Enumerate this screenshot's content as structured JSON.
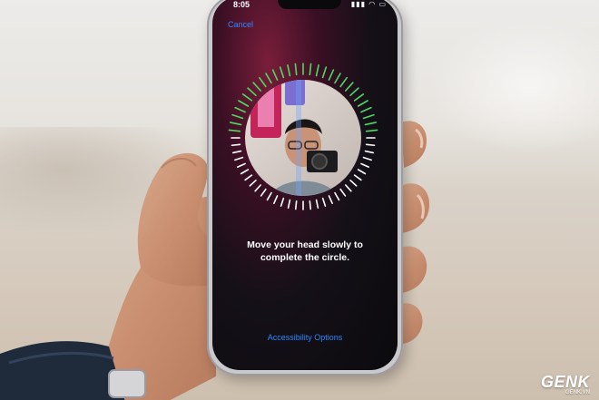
{
  "status_bar": {
    "time": "8:05",
    "icons": [
      "cellular-signal-icon",
      "wifi-icon",
      "battery-icon"
    ]
  },
  "setup": {
    "cancel_label": "Cancel",
    "instruction_line1": "Move your head slowly to",
    "instruction_line2": "complete the circle.",
    "accessibility_label": "Accessibility Options"
  },
  "scan_progress": 0.5,
  "watermark": {
    "logo": "GENK",
    "site": "GENK.VN"
  },
  "colors": {
    "link_blue": "#2f86ff",
    "tick_green": "#4cd964",
    "tick_white": "#ffffff"
  }
}
